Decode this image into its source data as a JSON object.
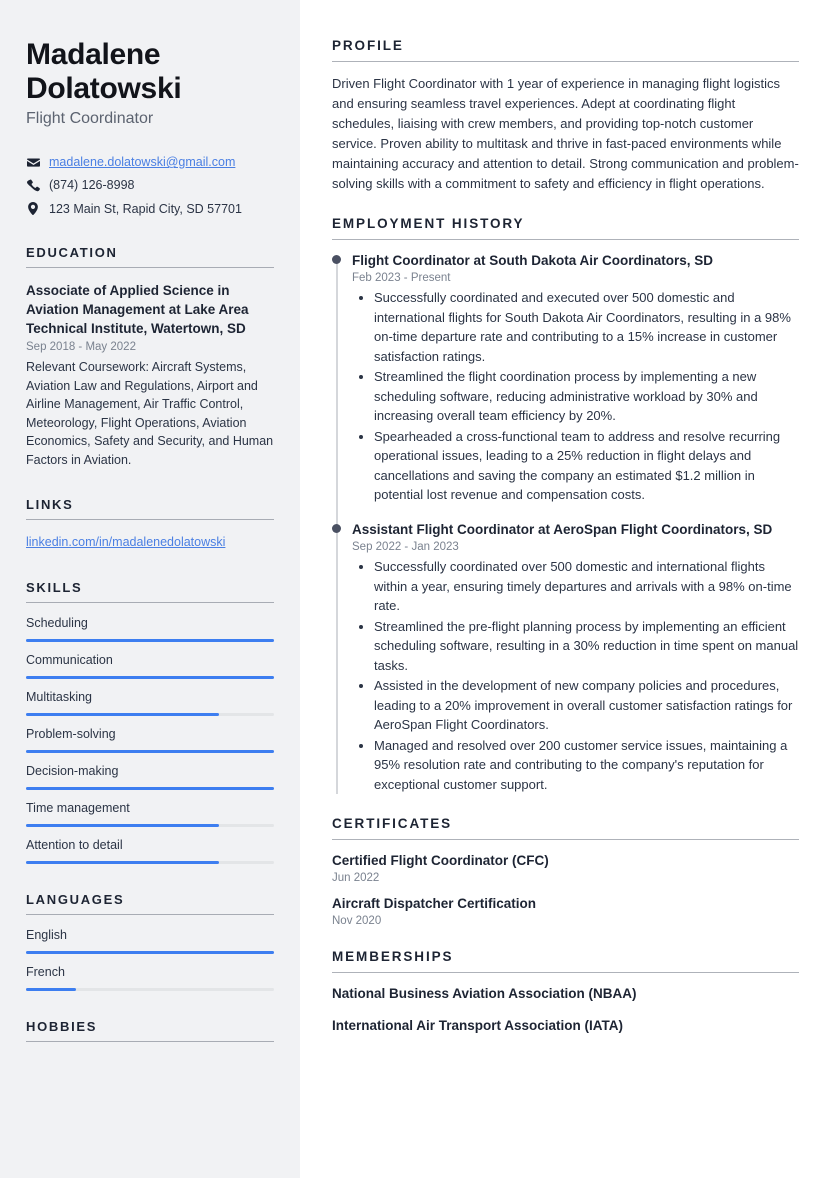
{
  "sidebar": {
    "name": "Madalene Dolatowski",
    "job_title": "Flight Coordinator",
    "contacts": [
      {
        "icon": "envelope-icon",
        "value": "madalene.dolatowski@gmail.com",
        "is_link": true
      },
      {
        "icon": "phone-icon",
        "value": "(874) 126-8998",
        "is_link": false
      },
      {
        "icon": "location-pin-icon",
        "value": "123 Main St, Rapid City, SD 57701",
        "is_link": false
      }
    ],
    "education": {
      "heading": "EDUCATION",
      "entries": [
        {
          "title": "Associate of Applied Science in Aviation Management at Lake Area Technical Institute, Watertown, SD",
          "date": "Sep 2018 - May 2022",
          "description": "Relevant Coursework: Aircraft Systems, Aviation Law and Regulations, Airport and Airline Management, Air Traffic Control, Meteorology, Flight Operations, Aviation Economics, Safety and Security, and Human Factors in Aviation."
        }
      ]
    },
    "links": {
      "heading": "LINKS",
      "items": [
        {
          "label": "linkedin.com/in/madalenedolatowski"
        }
      ]
    },
    "skills": {
      "heading": "SKILLS",
      "items": [
        {
          "label": "Scheduling",
          "level": 100
        },
        {
          "label": "Communication",
          "level": 100
        },
        {
          "label": "Multitasking",
          "level": 78
        },
        {
          "label": "Problem-solving",
          "level": 100
        },
        {
          "label": "Decision-making",
          "level": 100
        },
        {
          "label": "Time management",
          "level": 78
        },
        {
          "label": "Attention to detail",
          "level": 78
        }
      ]
    },
    "languages": {
      "heading": "LANGUAGES",
      "items": [
        {
          "label": "English",
          "level": 100
        },
        {
          "label": "French",
          "level": 20
        }
      ]
    },
    "hobbies": {
      "heading": "HOBBIES"
    }
  },
  "main": {
    "profile": {
      "heading": "PROFILE",
      "text": "Driven Flight Coordinator with 1 year of experience in managing flight logistics and ensuring seamless travel experiences. Adept at coordinating flight schedules, liaising with crew members, and providing top-notch customer service. Proven ability to multitask and thrive in fast-paced environments while maintaining accuracy and attention to detail. Strong communication and problem-solving skills with a commitment to safety and efficiency in flight operations."
    },
    "employment": {
      "heading": "EMPLOYMENT HISTORY",
      "jobs": [
        {
          "title": "Flight Coordinator at South Dakota Air Coordinators, SD",
          "date": "Feb 2023 - Present",
          "bullets": [
            "Successfully coordinated and executed over 500 domestic and international flights for South Dakota Air Coordinators, resulting in a 98% on-time departure rate and contributing to a 15% increase in customer satisfaction ratings.",
            "Streamlined the flight coordination process by implementing a new scheduling software, reducing administrative workload by 30% and increasing overall team efficiency by 20%.",
            "Spearheaded a cross-functional team to address and resolve recurring operational issues, leading to a 25% reduction in flight delays and cancellations and saving the company an estimated $1.2 million in potential lost revenue and compensation costs."
          ]
        },
        {
          "title": "Assistant Flight Coordinator at AeroSpan Flight Coordinators, SD",
          "date": "Sep 2022 - Jan 2023",
          "bullets": [
            "Successfully coordinated over 500 domestic and international flights within a year, ensuring timely departures and arrivals with a 98% on-time rate.",
            "Streamlined the pre-flight planning process by implementing an efficient scheduling software, resulting in a 30% reduction in time spent on manual tasks.",
            "Assisted in the development of new company policies and procedures, leading to a 20% improvement in overall customer satisfaction ratings for AeroSpan Flight Coordinators.",
            "Managed and resolved over 200 customer service issues, maintaining a 95% resolution rate and contributing to the company's reputation for exceptional customer support."
          ]
        }
      ]
    },
    "certificates": {
      "heading": "CERTIFICATES",
      "items": [
        {
          "title": "Certified Flight Coordinator (CFC)",
          "date": "Jun 2022"
        },
        {
          "title": "Aircraft Dispatcher Certification",
          "date": "Nov 2020"
        }
      ]
    },
    "memberships": {
      "heading": "MEMBERSHIPS",
      "items": [
        {
          "title": "National Business Aviation Association (NBAA)"
        },
        {
          "title": "International Air Transport Association (IATA)"
        }
      ]
    }
  },
  "colors": {
    "accent_blue": "#3d7ef0",
    "link_blue": "#4a7fe3",
    "sidebar_bg": "#f1f2f4",
    "heading_navy": "#1d2433",
    "muted_gray": "#7a828f"
  }
}
